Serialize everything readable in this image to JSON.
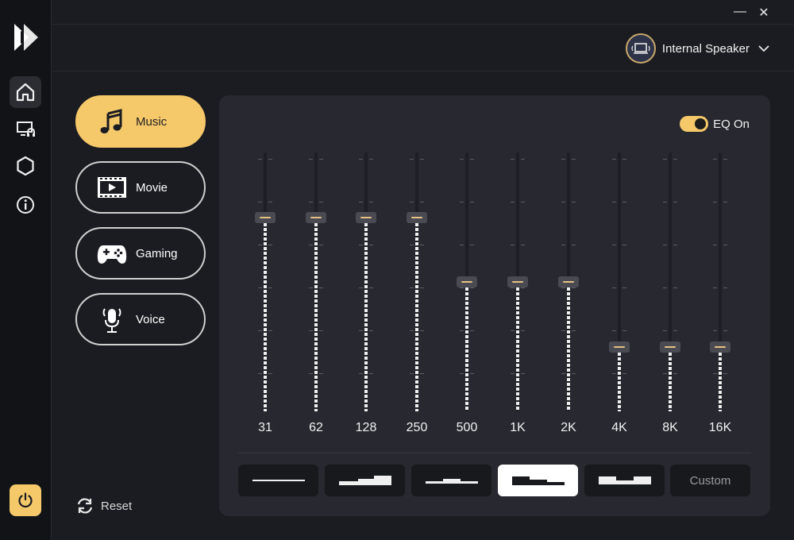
{
  "window": {
    "minimize_glyph": "—",
    "close_glyph": "✕"
  },
  "sidebar": {
    "items": [
      {
        "icon": "home-icon",
        "active": true
      },
      {
        "icon": "devices-icon",
        "active": false
      },
      {
        "icon": "settings-icon",
        "active": false
      },
      {
        "icon": "info-icon",
        "active": false
      }
    ],
    "power_icon": "power-icon"
  },
  "header": {
    "device_name": "Internal Speaker"
  },
  "presets": [
    {
      "label": "Music",
      "icon": "music-note-icon",
      "active": true
    },
    {
      "label": "Movie",
      "icon": "film-icon",
      "active": false
    },
    {
      "label": "Gaming",
      "icon": "gamepad-icon",
      "active": false
    },
    {
      "label": "Voice",
      "icon": "microphone-icon",
      "active": false
    }
  ],
  "reset_label": "Reset",
  "eq": {
    "toggle_label": "EQ On",
    "enabled": true,
    "bands": [
      {
        "freq": "31",
        "level": 0.75
      },
      {
        "freq": "62",
        "level": 0.75
      },
      {
        "freq": "128",
        "level": 0.75
      },
      {
        "freq": "250",
        "level": 0.75
      },
      {
        "freq": "500",
        "level": 0.5
      },
      {
        "freq": "1K",
        "level": 0.5
      },
      {
        "freq": "2K",
        "level": 0.5
      },
      {
        "freq": "4K",
        "level": 0.25
      },
      {
        "freq": "8K",
        "level": 0.25
      },
      {
        "freq": "16K",
        "level": 0.25
      }
    ],
    "curve_buttons": [
      {
        "name": "flat",
        "active": false
      },
      {
        "name": "bass-boost",
        "active": false
      },
      {
        "name": "mid-boost",
        "active": false
      },
      {
        "name": "bass-cut",
        "active": true
      },
      {
        "name": "treble-dip",
        "active": false
      },
      {
        "name": "custom",
        "label": "Custom",
        "active": false
      }
    ]
  },
  "colors": {
    "accent": "#f5c86a",
    "background": "#1b1c21",
    "panel": "#272830",
    "rail": "#121316"
  }
}
